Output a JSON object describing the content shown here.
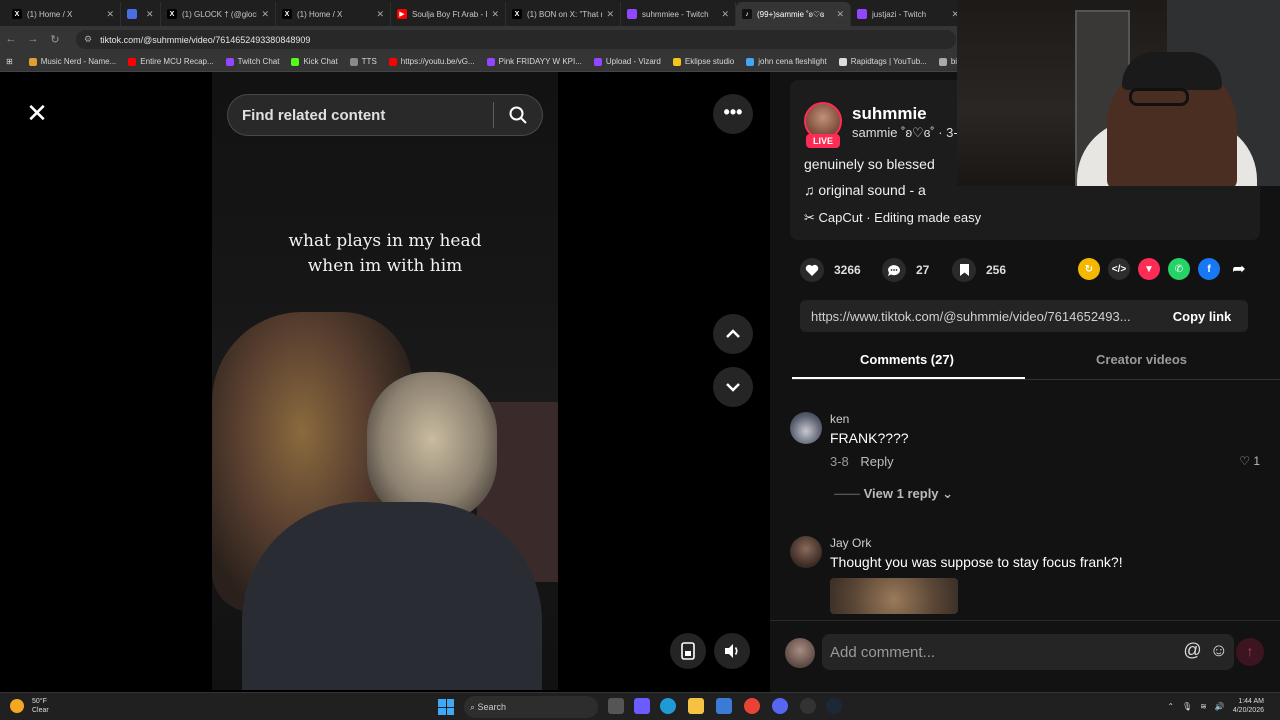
{
  "browser": {
    "tabs": [
      {
        "label": "(1) Home / X",
        "icon": "x-logo-icon",
        "color": "#000000"
      },
      {
        "label": "",
        "icon": "generic-page-icon",
        "color": "#4a6ee0"
      },
      {
        "label": "(1) GLOCK † (@glock",
        "icon": "x-logo-icon",
        "color": "#000000"
      },
      {
        "label": "(1) Home / X",
        "icon": "x-logo-icon",
        "color": "#000000"
      },
      {
        "label": "Soulja Boy Ft Arab - I",
        "icon": "youtube-icon",
        "color": "#ff0000"
      },
      {
        "label": "(1) BON on X: \"That n",
        "icon": "x-logo-icon",
        "color": "#000000"
      },
      {
        "label": "suhmmiee - Twitch",
        "icon": "twitch-icon",
        "color": "#9146ff"
      },
      {
        "label": "(99+)sammie ˚ʚ♡ɞ",
        "icon": "tiktok-icon",
        "color": "#000000",
        "active": true
      },
      {
        "label": "justjazi - Twitch",
        "icon": "twitch-icon",
        "color": "#9146ff"
      }
    ],
    "url": "tiktok.com/@suhmmie/video/7614652493380848909",
    "bookmarks": [
      {
        "label": "Music Nerd - Name...",
        "color": "#e0a030"
      },
      {
        "label": "Entire MCU Recap...",
        "color": "#ff0000"
      },
      {
        "label": "Twitch Chat",
        "color": "#9146ff"
      },
      {
        "label": "Kick Chat",
        "color": "#53fc18"
      },
      {
        "label": "TTS",
        "color": "#888888"
      },
      {
        "label": "https://youtu.be/vG...",
        "color": "#ff0000"
      },
      {
        "label": "Pink FRIDAYY W KPI...",
        "color": "#9146ff"
      },
      {
        "label": "Upload - Vizard",
        "color": "#9146ff"
      },
      {
        "label": "Eklipse studio",
        "color": "#f5c518"
      },
      {
        "label": "john cena fleshlight",
        "color": "#3fa9f5"
      },
      {
        "label": "Rapidtags | YouTub...",
        "color": "#dddddd"
      },
      {
        "label": "bih links",
        "color": "#aaaaaa"
      }
    ]
  },
  "video": {
    "caption_line1": "what plays in my head",
    "caption_line2": "when im with him",
    "search_placeholder": "Find related content"
  },
  "post": {
    "username": "suhmmie",
    "nickname": "sammie ˚ʚ♡ɞ˚ · 3-",
    "live_label": "LIVE",
    "description": "genuinely so blessed",
    "music": "original sound - a",
    "capcut": "CapCut · Editing made easy",
    "likes": "3266",
    "comments_count": "27",
    "saves": "256",
    "link": "https://www.tiktok.com/@suhmmie/video/7614652493...",
    "copy_link_label": "Copy link"
  },
  "tabs": {
    "comments": "Comments (27)",
    "creator": "Creator videos"
  },
  "comments": [
    {
      "name": "ken",
      "text": "FRANK????",
      "date": "3-8",
      "reply_label": "Reply",
      "likes": "1",
      "view_replies": "View 1 reply"
    },
    {
      "name": "Jay Ork",
      "text": "Thought you was suppose to stay focus frank?!"
    }
  ],
  "comment_input": {
    "placeholder": "Add comment..."
  },
  "taskbar": {
    "weather_temp": "50°F",
    "weather_desc": "Clear",
    "search_label": "Search",
    "time": "1:44 AM",
    "date": "4/20/2026"
  },
  "colors": {
    "accent": "#fe2c55",
    "like": "#ffffff"
  }
}
